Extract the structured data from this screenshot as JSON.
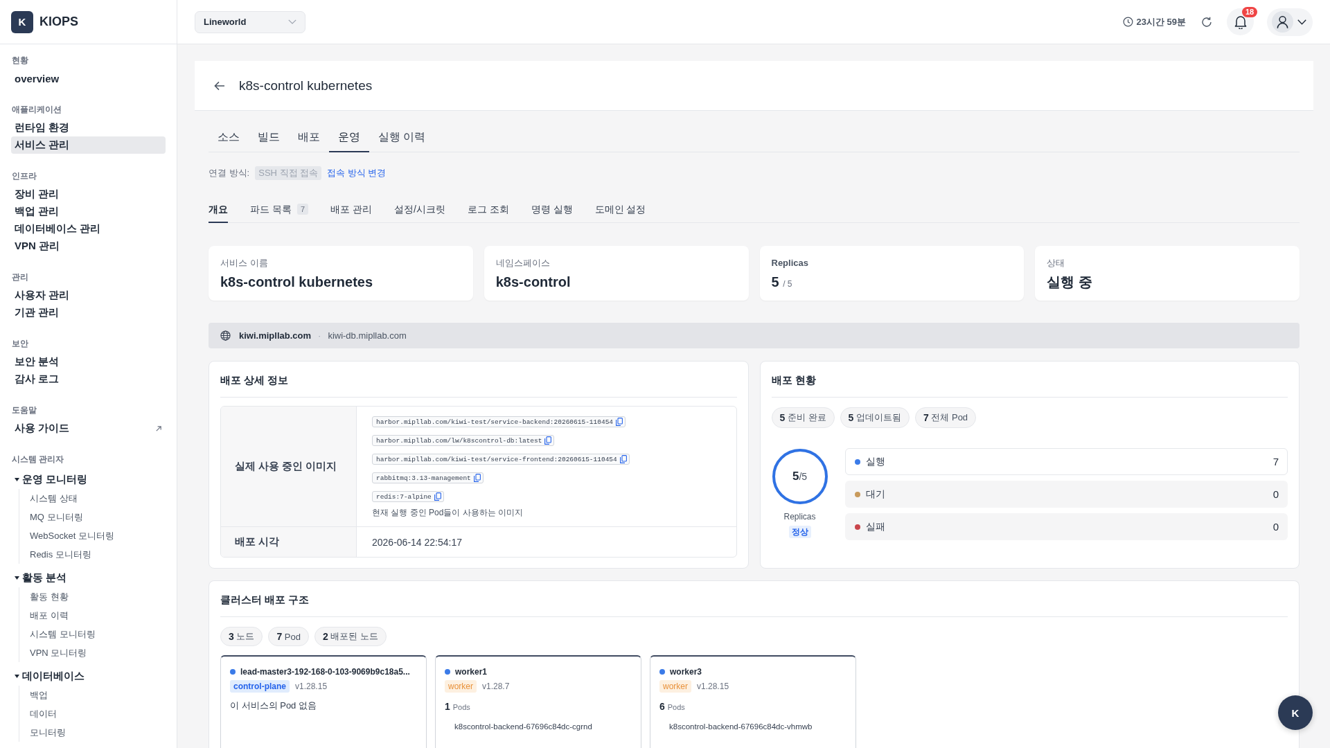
{
  "sidebar": {
    "brand": {
      "letter": "K",
      "name": "KIOPS"
    },
    "sections": [
      {
        "title": "현황",
        "items": [
          {
            "label": "overview",
            "selected": false,
            "external": false
          }
        ]
      },
      {
        "title": "애플리케이션",
        "items": [
          {
            "label": "런타임 환경",
            "selected": false,
            "external": false
          },
          {
            "label": "서비스 관리",
            "selected": true,
            "external": false
          }
        ]
      },
      {
        "title": "인프라",
        "items": [
          {
            "label": "장비 관리",
            "selected": false,
            "external": false
          },
          {
            "label": "백업 관리",
            "selected": false,
            "external": false
          },
          {
            "label": "데이터베이스 관리",
            "selected": false,
            "external": false
          },
          {
            "label": "VPN 관리",
            "selected": false,
            "external": false
          }
        ]
      },
      {
        "title": "관리",
        "items": [
          {
            "label": "사용자 관리",
            "selected": false,
            "external": false
          },
          {
            "label": "기관 관리",
            "selected": false,
            "external": false
          }
        ]
      },
      {
        "title": "보안",
        "items": [
          {
            "label": "보안 분석",
            "selected": false,
            "external": false
          },
          {
            "label": "감사 로그",
            "selected": false,
            "external": false
          }
        ]
      },
      {
        "title": "도움말",
        "items": [
          {
            "label": "사용 가이드",
            "selected": false,
            "external": true
          }
        ]
      },
      {
        "title": "시스템 관리자",
        "groups": [
          {
            "label": "운영 모니터링",
            "expanded": true,
            "children": [
              {
                "label": "시스템 상태",
                "selected": false
              },
              {
                "label": "MQ 모니터링",
                "selected": false
              },
              {
                "label": "WebSocket 모니터링",
                "selected": false
              },
              {
                "label": "Redis 모니터링",
                "selected": false
              }
            ]
          },
          {
            "label": "활동 분석",
            "expanded": true,
            "children": [
              {
                "label": "활동 현황",
                "selected": false
              },
              {
                "label": "배포 이력",
                "selected": false
              },
              {
                "label": "시스템 모니터링",
                "selected": false
              },
              {
                "label": "VPN 모니터링",
                "selected": false
              }
            ]
          },
          {
            "label": "데이터베이스",
            "expanded": true,
            "children": [
              {
                "label": "백업",
                "selected": false
              },
              {
                "label": "데이터",
                "selected": false
              },
              {
                "label": "모니터링",
                "selected": false
              }
            ]
          }
        ]
      }
    ]
  },
  "header": {
    "workspace": "Lineworld",
    "session_time": "23시간 59분",
    "notification_count": "18"
  },
  "page": {
    "title": "k8s-control kubernetes"
  },
  "tabs": [
    {
      "label": "소스",
      "selected": false
    },
    {
      "label": "빌드",
      "selected": false
    },
    {
      "label": "배포",
      "selected": false
    },
    {
      "label": "운영",
      "selected": true
    },
    {
      "label": "실행 이력",
      "selected": false
    }
  ],
  "connection": {
    "label": "연결 방식:",
    "method": "SSH 직접 접속",
    "change_link": "접속 방식 변경"
  },
  "subtabs": [
    {
      "label": "개요",
      "selected": true
    },
    {
      "label": "파드 목록",
      "count": "7",
      "selected": false
    },
    {
      "label": "배포 관리",
      "selected": false
    },
    {
      "label": "설정/시크릿",
      "selected": false
    },
    {
      "label": "로그 조회",
      "selected": false
    },
    {
      "label": "명령 실행",
      "selected": false
    },
    {
      "label": "도메인 설정",
      "selected": false
    }
  ],
  "summary_cards": [
    {
      "kind": "text",
      "label": "서비스 이름",
      "value": "k8s-control kubernetes"
    },
    {
      "kind": "text",
      "label": "네임스페이스",
      "value": "k8s-control"
    },
    {
      "kind": "ratio",
      "label": "Replicas",
      "value": "5",
      "total": "/ 5"
    },
    {
      "kind": "text",
      "label": "상태",
      "value": "실행 중"
    }
  ],
  "domains": {
    "hosts": [
      {
        "name": "kiwi.mipllab.com",
        "primary": true
      },
      {
        "name": "kiwi-db.mipllab.com",
        "primary": false
      }
    ],
    "separator": "·"
  },
  "deploy_detail": {
    "title": "배포 상세 정보",
    "rows": [
      {
        "kind": "images",
        "label": "실제 사용 중인 이미지",
        "images": [
          "harbor.mipllab.com/kiwi-test/service-backend:20260615-110454",
          "harbor.mipllab.com/lw/k8scontrol-db:latest",
          "harbor.mipllab.com/kiwi-test/service-frontend:20260615-110454",
          "rabbitmq:3.13-management",
          "redis:7-alpine"
        ],
        "note": "현재 실행 중인 Pod들이 사용하는 이미지"
      },
      {
        "kind": "text",
        "label": "배포 시각",
        "value": "2026-06-14 22:54:17"
      }
    ]
  },
  "deploy_status": {
    "title": "배포 현황",
    "chips": [
      {
        "count": "5",
        "label": "준비 완료"
      },
      {
        "count": "5",
        "label": "업데이트됨"
      },
      {
        "count": "7",
        "label": "전체 Pod"
      }
    ],
    "ring": {
      "value": "5",
      "total": "/5",
      "level": 1,
      "label": "Replicas",
      "status": "정상"
    },
    "states": [
      {
        "label": "실행",
        "count": "7",
        "color": "#3b7be8",
        "active": true
      },
      {
        "label": "대기",
        "count": "0",
        "color": "#c89a5c",
        "active": false
      },
      {
        "label": "실패",
        "count": "0",
        "color": "#c9464c",
        "active": false
      }
    ]
  },
  "cluster": {
    "title": "클러스터 배포 구조",
    "chips": [
      {
        "count": "3",
        "label": "노드"
      },
      {
        "count": "7",
        "label": "Pod"
      },
      {
        "count": "2",
        "label": "배포된 노드"
      }
    ],
    "nodes": [
      {
        "kind": "control-plane",
        "name": "lead-master3-192-168-0-103-9069b9c18a5...",
        "role": "control-plane",
        "version": "v1.28.15",
        "empty_text": "이 서비스의 Pod 없음"
      },
      {
        "kind": "worker",
        "name": "worker1",
        "role": "worker",
        "version": "v1.28.7",
        "pod_count": "1",
        "pod_unit": "Pods",
        "pods": [
          "k8scontrol-backend-67696c84dc-cgrnd"
        ]
      },
      {
        "kind": "worker",
        "name": "worker3",
        "role": "worker",
        "version": "v1.28.15",
        "pod_count": "6",
        "pod_unit": "Pods",
        "pods": [
          "k8scontrol-backend-67696c84dc-vhmwb"
        ]
      }
    ]
  },
  "assistant_button": {
    "label": "K"
  }
}
